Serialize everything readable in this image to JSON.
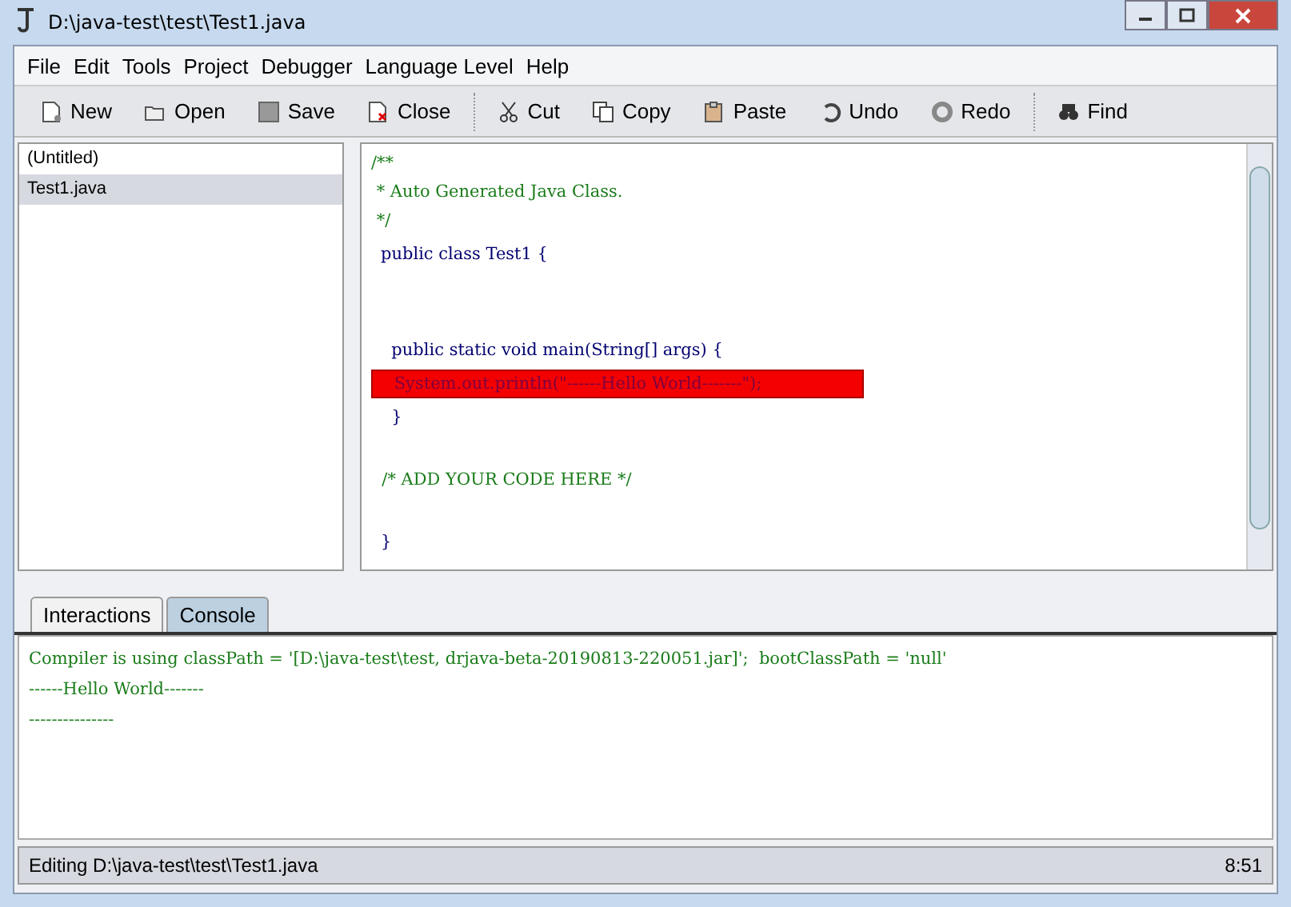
{
  "window": {
    "title": "D:\\java-test\\test\\Test1.java"
  },
  "menu": [
    "File",
    "Edit",
    "Tools",
    "Project",
    "Debugger",
    "Language Level",
    "Help"
  ],
  "toolbar": [
    {
      "label": "New",
      "kind": "new"
    },
    {
      "label": "Open",
      "kind": "open"
    },
    {
      "label": "Save",
      "kind": "save"
    },
    {
      "label": "Close",
      "kind": "close"
    },
    {
      "label": "Cut",
      "kind": "cut",
      "group_start": true
    },
    {
      "label": "Copy",
      "kind": "copy"
    },
    {
      "label": "Paste",
      "kind": "paste"
    },
    {
      "label": "Undo",
      "kind": "undo"
    },
    {
      "label": "Redo",
      "kind": "redo"
    },
    {
      "label": "Find",
      "kind": "find",
      "group_start": true
    }
  ],
  "documents": [
    {
      "label": "(Untitled)",
      "selected": false
    },
    {
      "label": "Test1.java",
      "selected": true
    }
  ],
  "editor": {
    "lines": [
      {
        "kind": "comment",
        "text": "/**"
      },
      {
        "kind": "comment",
        "text": " * Auto Generated Java Class."
      },
      {
        "kind": "comment",
        "text": " */"
      },
      {
        "kind": "code",
        "text": "public class Test1 {"
      },
      {
        "kind": "blank"
      },
      {
        "kind": "blank"
      },
      {
        "kind": "code",
        "text": "  public static void main(String[] args) {"
      },
      {
        "kind": "error",
        "text": "    System.out.println(\"------Hello World-------\");"
      },
      {
        "kind": "code",
        "text": "  }"
      },
      {
        "kind": "blank"
      },
      {
        "kind": "comment",
        "text": "  /* ADD YOUR CODE HERE */"
      },
      {
        "kind": "blank"
      },
      {
        "kind": "code",
        "text": "}"
      }
    ]
  },
  "bottom_tabs": [
    {
      "label": "Interactions",
      "selected": false
    },
    {
      "label": "Console",
      "selected": true
    }
  ],
  "console": [
    "Compiler is using classPath = '[D:\\java-test\\test, drjava-beta-20190813-220051.jar]';  bootClassPath = 'null'",
    "------Hello World-------",
    "---------------"
  ],
  "status_bar": {
    "message": "Editing D:\\java-test\\test\\Test1.java",
    "position": "8:51"
  }
}
